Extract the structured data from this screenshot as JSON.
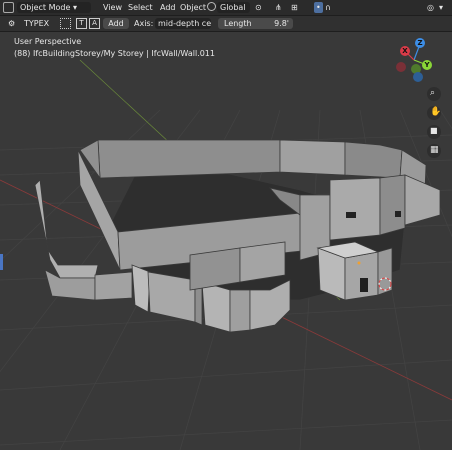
{
  "header": {
    "mode_label": "Object Mode",
    "menu": [
      "View",
      "Select",
      "Add",
      "Object"
    ],
    "transform_orientation": "Global"
  },
  "tool_settings": {
    "wall_type": "TYPEX",
    "add_label": "Add",
    "axis_label": "Axis:",
    "axis_value": "mid-depth ce...",
    "length_label": "Length",
    "length_value": "9.8'"
  },
  "viewport": {
    "view_name": "User Perspective",
    "object_path": "(88) IfcBuildingStorey/My Storey | IfcWall/Wall.011"
  },
  "gizmo": {
    "axes": [
      "X",
      "Y",
      "Z"
    ],
    "colors": {
      "x": "#d93b48",
      "y": "#8ad637",
      "z": "#3d8ee6"
    }
  },
  "icons": [
    "cursor-icon",
    "object-type-icon",
    "grid-icon",
    "search-zoom-icon",
    "hand-pan-icon",
    "camera-icon",
    "perspective-grid-icon"
  ]
}
